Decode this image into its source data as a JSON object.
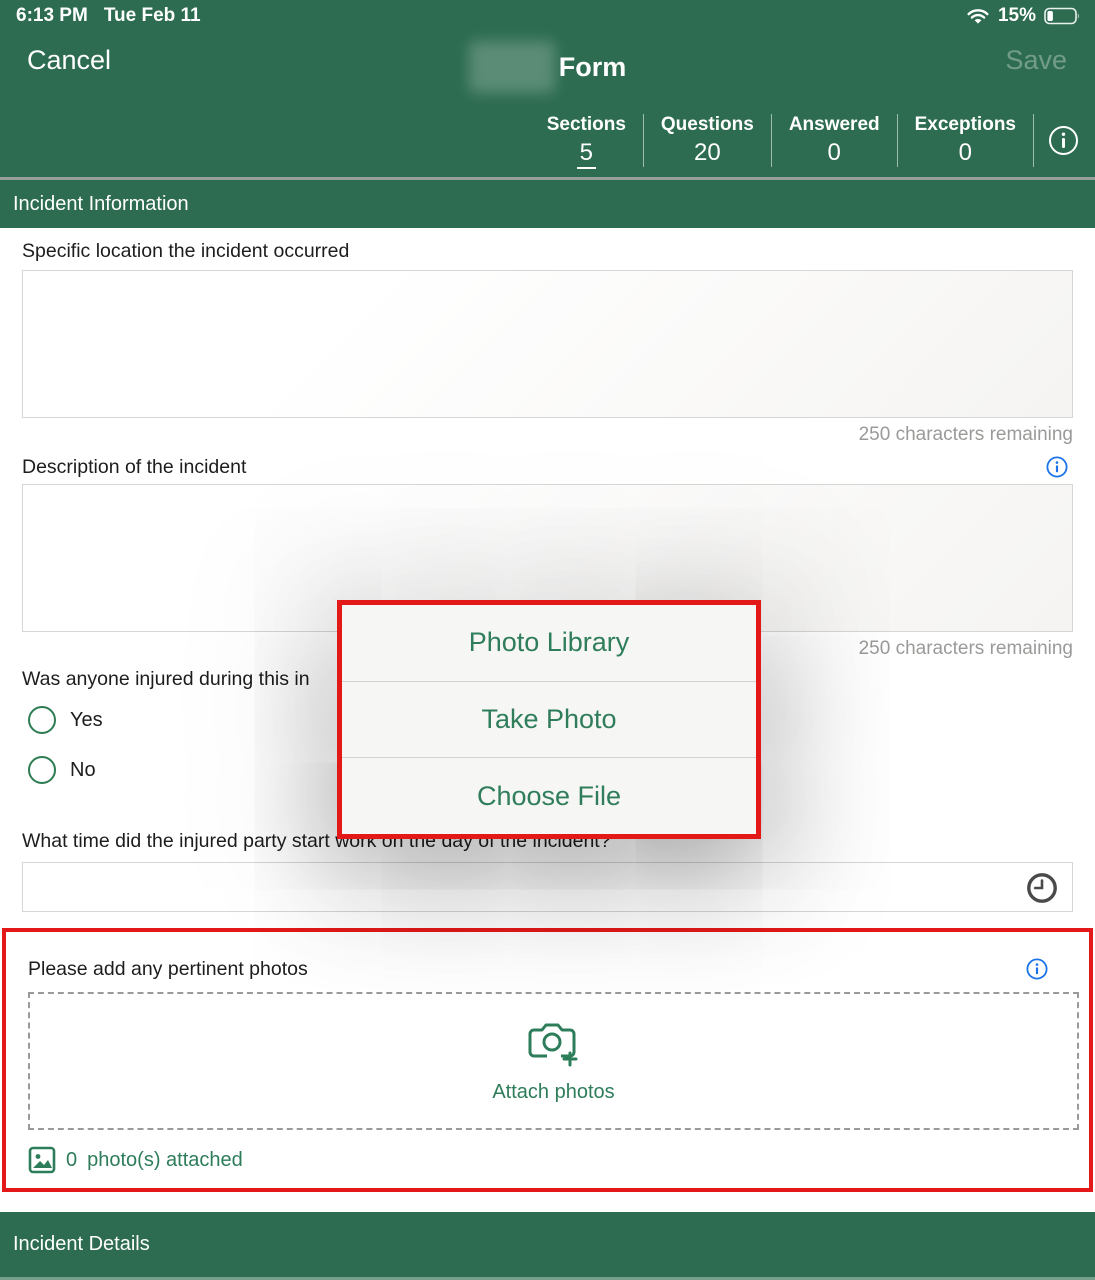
{
  "status_bar": {
    "time": "6:13 PM",
    "date": "Tue Feb 11",
    "battery_percent": "15%"
  },
  "header": {
    "cancel_label": "Cancel",
    "title": "Form",
    "save_label": "Save",
    "stats": [
      {
        "label": "Sections",
        "value": "5"
      },
      {
        "label": "Questions",
        "value": "20"
      },
      {
        "label": "Answered",
        "value": "0"
      },
      {
        "label": "Exceptions",
        "value": "0"
      }
    ]
  },
  "sections": {
    "top": "Incident Information",
    "bottom": "Incident Details"
  },
  "questions": {
    "location": {
      "label": "Specific location the incident occurred",
      "char_remaining": "250 characters remaining"
    },
    "description": {
      "label": "Description of the incident",
      "char_remaining": "250 characters remaining"
    },
    "injured": {
      "label": "Was anyone injured during this in",
      "options": [
        "Yes",
        "No"
      ]
    },
    "time": {
      "label": "What time did the injured party start work on the day of the incident?"
    },
    "photos": {
      "label": "Please add any pertinent photos",
      "attach_label": "Attach photos",
      "count": "0",
      "count_suffix": "photo(s) attached"
    }
  },
  "action_sheet": {
    "options": [
      "Photo Library",
      "Take Photo",
      "Choose File"
    ]
  },
  "icons": {
    "wifi": "wifi",
    "battery": "battery-low",
    "header_info": "info-circle",
    "field_info": "info-circle",
    "clock": "clock",
    "camera_add": "camera-plus",
    "photo": "image"
  },
  "colors": {
    "header_green": "#2d6c50",
    "accent_green": "#2e7d5a",
    "info_blue": "#1a73e8",
    "annotation_red": "#e31919"
  }
}
